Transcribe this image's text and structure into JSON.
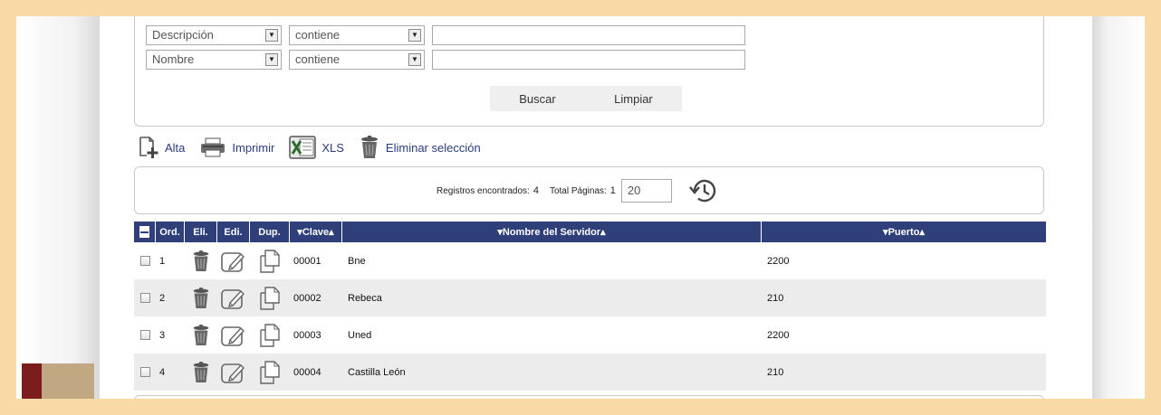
{
  "filters": {
    "rows": [
      {
        "field": "Descripción",
        "operator": "contiene",
        "value": ""
      },
      {
        "field": "Nombre",
        "operator": "contiene",
        "value": ""
      }
    ],
    "buscar_label": "Buscar",
    "limpiar_label": "Limpiar"
  },
  "toolbar": {
    "alta_label": "Alta",
    "imprimir_label": "Imprimir",
    "xls_label": "XLS",
    "eliminar_label": "Eliminar selección"
  },
  "pager": {
    "registros_label": "Registros encontrados:",
    "registros_value": "4",
    "paginas_label": "Total Páginas:",
    "paginas_value": "1",
    "page_size": "20"
  },
  "grid": {
    "headers": {
      "ord": "Ord.",
      "eli": "Eli.",
      "edi": "Edi.",
      "dup": "Dup.",
      "clave": "▾Clave▴",
      "nombre": "▾Nombre del Servidor▴",
      "puerto": "▾Puerto▴"
    },
    "rows": [
      {
        "ord": "1",
        "clave": "00001",
        "nombre": "Bne",
        "puerto": "2200"
      },
      {
        "ord": "2",
        "clave": "00002",
        "nombre": "Rebeca",
        "puerto": "210"
      },
      {
        "ord": "3",
        "clave": "00003",
        "nombre": "Uned",
        "puerto": "2200"
      },
      {
        "ord": "4",
        "clave": "00004",
        "nombre": "Castilla León",
        "puerto": "210"
      }
    ]
  },
  "colors": {
    "header_bg": "#2f3f7a",
    "page_bg": "#f9d9a6",
    "link": "#2b3c7a",
    "alt_row": "#ececec"
  }
}
